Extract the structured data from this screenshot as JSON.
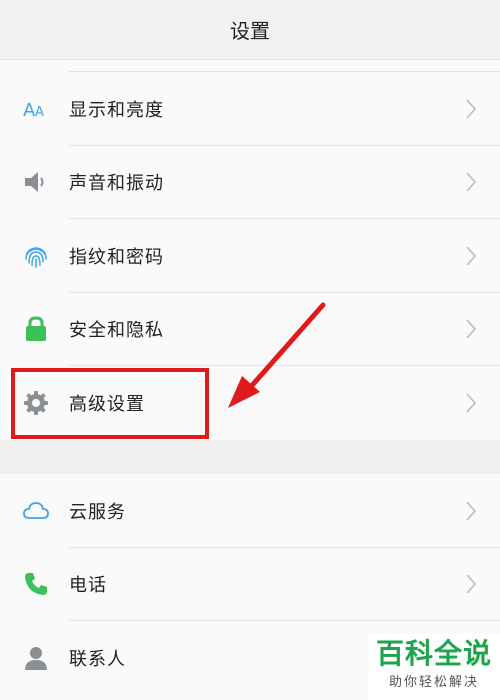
{
  "header": {
    "title": "设置"
  },
  "section1": {
    "items": [
      {
        "label": "显示和亮度",
        "icon": "display-text-icon"
      },
      {
        "label": "声音和振动",
        "icon": "speaker-icon"
      },
      {
        "label": "指纹和密码",
        "icon": "fingerprint-icon"
      },
      {
        "label": "安全和隐私",
        "icon": "lock-icon"
      },
      {
        "label": "高级设置",
        "icon": "gear-icon"
      }
    ]
  },
  "section2": {
    "items": [
      {
        "label": "云服务",
        "icon": "cloud-icon"
      },
      {
        "label": "电话",
        "icon": "phone-icon"
      },
      {
        "label": "联系人",
        "icon": "person-icon"
      }
    ]
  },
  "watermark": {
    "main": "百科全说",
    "sub": "助你轻松解决"
  },
  "colors": {
    "accent_blue": "#3ea6e8",
    "green": "#3cc05a",
    "grey_icon": "#8a8f96",
    "annotation_red": "#e01a1a"
  }
}
